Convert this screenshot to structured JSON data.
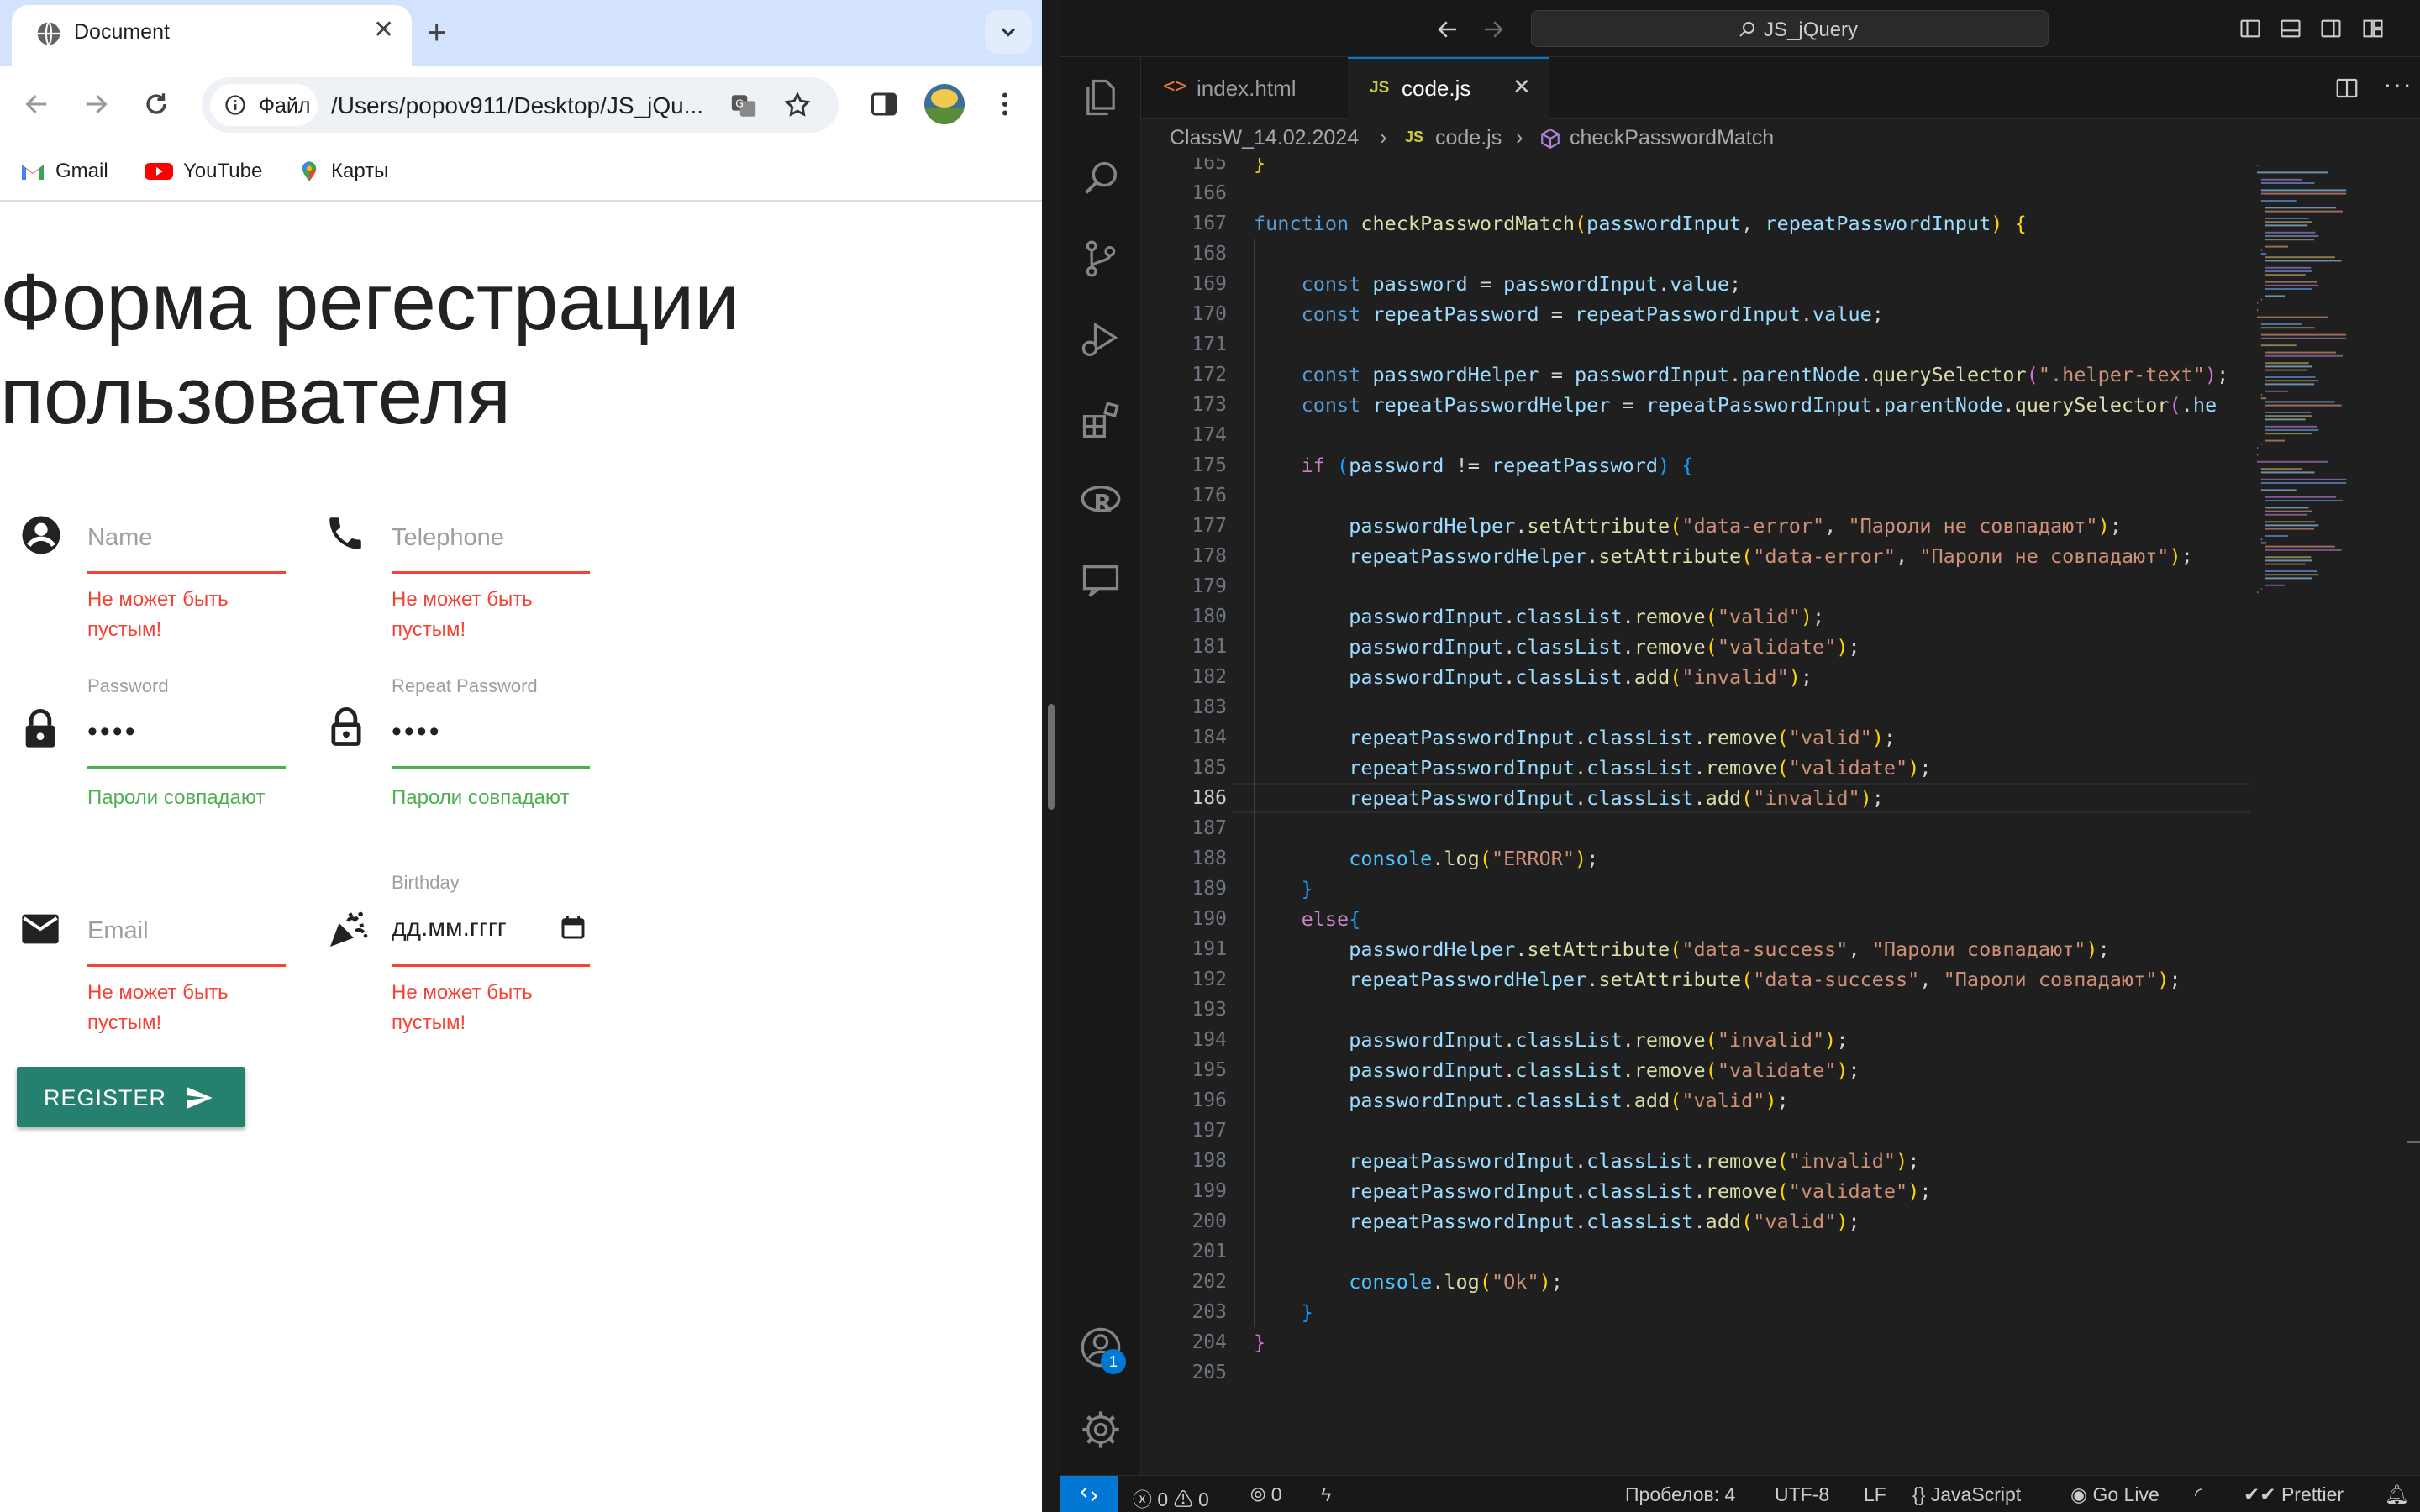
{
  "browser": {
    "tab_title": "Document",
    "site_chip": "Файл",
    "url": "/Users/popov911/Desktop/JS_jQu...",
    "bookmarks": [
      "Gmail",
      "YouTube",
      "Карты"
    ]
  },
  "form": {
    "heading": "Форма регестрации пользователя",
    "name_placeholder": "Name",
    "telephone_placeholder": "Telephone",
    "password_label": "Password",
    "password_value": "••••",
    "repeat_password_label": "Repeat Password",
    "repeat_password_value": "••••",
    "email_placeholder": "Email",
    "birthday_label": "Birthday",
    "birthday_value": "дд.мм.гггг",
    "error_text_line1": "Не может быть",
    "error_text_line2": "пустым!",
    "success_text": "Пароли совпадают",
    "register_label": "REGISTER"
  },
  "vscode": {
    "command_center": "JS_jQuery",
    "tabs": [
      {
        "label": "index.html",
        "icon": "html-file-icon",
        "active": false
      },
      {
        "label": "code.js",
        "icon": "js-file-icon",
        "active": true
      }
    ],
    "breadcrumbs": {
      "folder": "ClassW_14.02.2024",
      "file_badge": "JS",
      "file": "code.js",
      "symbol": "checkPasswordMatch"
    },
    "current_line": 186,
    "first_line": 165,
    "lines": [
      "}",
      "",
      "function checkPasswordMatch(passwordInput, repeatPasswordInput) {",
      "",
      "    const password = passwordInput.value;",
      "    const repeatPassword = repeatPasswordInput.value;",
      "",
      "    const passwordHelper = passwordInput.parentNode.querySelector(\".helper-text\");",
      "    const repeatPasswordHelper = repeatPasswordInput.parentNode.querySelector(\".he",
      "",
      "    if (password != repeatPassword) {",
      "",
      "        passwordHelper.setAttribute(\"data-error\", \"Пароли не совпадают\");",
      "        repeatPasswordHelper.setAttribute(\"data-error\", \"Пароли не совпадают\");",
      "",
      "        passwordInput.classList.remove(\"valid\");",
      "        passwordInput.classList.remove(\"validate\");",
      "        passwordInput.classList.add(\"invalid\");",
      "",
      "        repeatPasswordInput.classList.remove(\"valid\");",
      "        repeatPasswordInput.classList.remove(\"validate\");",
      "        repeatPasswordInput.classList.add(\"invalid\");",
      "",
      "        console.log(\"ERROR\");",
      "    }",
      "    else{",
      "        passwordHelper.setAttribute(\"data-success\", \"Пароли совпадают\");",
      "        repeatPasswordHelper.setAttribute(\"data-success\", \"Пароли совпадают\");",
      "",
      "        passwordInput.classList.remove(\"invalid\");",
      "        passwordInput.classList.remove(\"validate\");",
      "        passwordInput.classList.add(\"valid\");",
      "",
      "        repeatPasswordInput.classList.remove(\"invalid\");",
      "        repeatPasswordInput.classList.remove(\"validate\");",
      "        repeatPasswordInput.classList.add(\"valid\");",
      "",
      "        console.log(\"Ok\");",
      "    }",
      "}",
      ""
    ],
    "status": {
      "errors": "0",
      "warnings": "0",
      "ports": "0",
      "indent": "Пробелов: 4",
      "encoding": "UTF-8",
      "eol": "LF",
      "language": "JavaScript",
      "go_live": "Go Live",
      "prettier": "Prettier"
    },
    "accounts_badge": "1",
    "colors": {
      "accent": "#0078d4",
      "button": "#26806f",
      "error": "#f44336",
      "success": "#4caf50"
    }
  }
}
